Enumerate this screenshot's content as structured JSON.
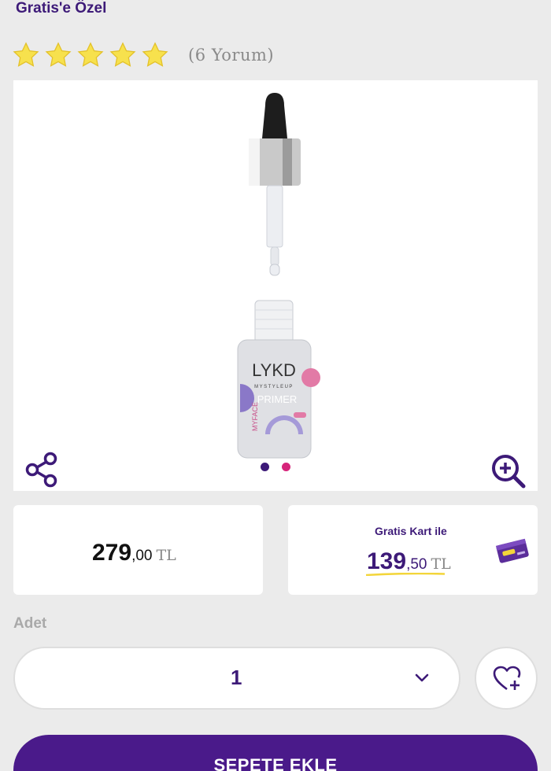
{
  "promo": {
    "title": "Gratis'e Özel"
  },
  "rating": {
    "stars": 5,
    "max_stars": 5,
    "reviews_label": "(6 Yorum)"
  },
  "product_image": {
    "brand": "LYKD",
    "sub_brand": "MYSTYLEUP",
    "line": "MYFACE",
    "product_word": "PRIMER",
    "slides_total": 2,
    "active_slide": 1
  },
  "price": {
    "integer": "279",
    "decimal": ",00",
    "currency": "TL"
  },
  "card_price": {
    "label": "Gratis Kart ile",
    "integer": "139",
    "decimal": ",50",
    "currency": "TL"
  },
  "quantity": {
    "label": "Adet",
    "value": "1"
  },
  "cart": {
    "button_label": "SEPETE EKLE"
  },
  "colors": {
    "brand_purple": "#4a1a8a",
    "title_purple": "#3d1a78",
    "star_yellow": "#f7e14d",
    "dot_active": "#3d1a78",
    "dot_inactive": "#d6247a",
    "underline_yellow": "#f3d53a"
  },
  "icons": {
    "share": "share-icon",
    "zoom": "zoom-in-icon",
    "favorite": "heart-plus-icon",
    "dropdown": "chevron-down-icon",
    "star": "star-icon"
  }
}
